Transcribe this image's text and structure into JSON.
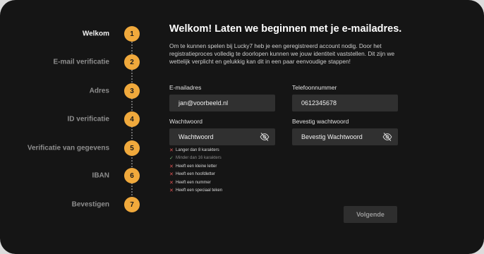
{
  "steps": [
    {
      "label": "Welkom",
      "number": "1",
      "active": true
    },
    {
      "label": "E-mail verificatie",
      "number": "2",
      "active": false
    },
    {
      "label": "Adres",
      "number": "3",
      "active": false
    },
    {
      "label": "ID verificatie",
      "number": "4",
      "active": false
    },
    {
      "label": "Verificatie van gegevens",
      "number": "5",
      "active": false
    },
    {
      "label": "IBAN",
      "number": "6",
      "active": false
    },
    {
      "label": "Bevestigen",
      "number": "7",
      "active": false
    }
  ],
  "colors": {
    "accent": "#f0a93c",
    "background": "#151515",
    "input": "#303030"
  },
  "form": {
    "title": "Welkom! Laten we beginnen met je e-mailadres.",
    "intro": "Om te kunnen spelen bij Lucky7 heb je een geregistreerd account nodig. Door het registratieproces volledig te doorlopen kunnen we jouw identiteit vaststellen. Dit zijn we wettelijk verplicht en gelukkig kan dit in een paar eenvoudige stappen!",
    "email": {
      "label": "E-mailadres",
      "value": "jan@voorbeeld.nl"
    },
    "phone": {
      "label": "Telefoonnummer",
      "value": "0612345678"
    },
    "password": {
      "label": "Wachtwoord",
      "placeholder": "Wachtwoord",
      "icon": "eye-off-icon"
    },
    "confirm_password": {
      "label": "Bevestig wachtwoord",
      "placeholder": "Bevestig Wachtwoord",
      "icon": "eye-off-icon"
    },
    "rules": [
      {
        "text": "Langer dan 8 karakters",
        "met": false
      },
      {
        "text": "Minder dan 16 karakters",
        "met": true
      },
      {
        "text": "Heeft een kleine letter",
        "met": false
      },
      {
        "text": "Heeft een hoofdletter",
        "met": false
      },
      {
        "text": "Heeft een nummer",
        "met": false
      },
      {
        "text": "Heeft een speciaal teken",
        "met": false
      }
    ],
    "next_label": "Volgende"
  }
}
